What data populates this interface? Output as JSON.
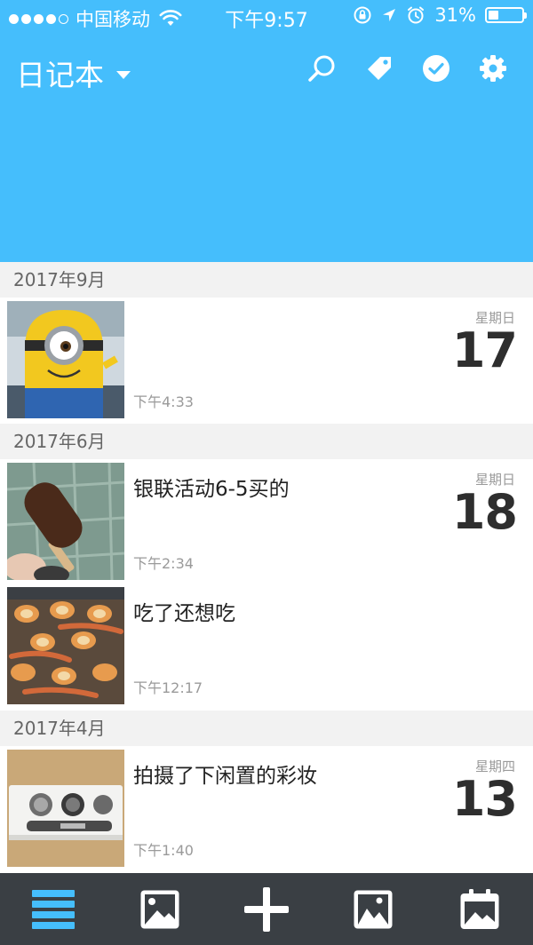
{
  "status_bar": {
    "carrier": "中国移动",
    "time": "下午9:57",
    "battery_percent": "31%",
    "battery_level": 0.31,
    "signal_filled": 4,
    "signal_total": 5,
    "icons": [
      "signal-dots-icon",
      "wifi-icon",
      "orientation-lock-icon",
      "location-arrow-icon",
      "alarm-icon",
      "battery-icon"
    ]
  },
  "nav": {
    "title": "日记本",
    "actions": [
      "search-icon",
      "tag-icon",
      "check-circle-icon",
      "gear-icon"
    ]
  },
  "colors": {
    "header_blue": "#45befc",
    "tabbar_bg": "#3a3f44",
    "active_tab": "#45befc",
    "month_bg": "#f2f2f2"
  },
  "groups": [
    {
      "month": "2017年9月",
      "weekday": "星期日",
      "day": "17",
      "entries": [
        {
          "title": "",
          "time": "下午4:33",
          "thumbnail": "minion-photo"
        }
      ]
    },
    {
      "month": "2017年6月",
      "weekday": "星期日",
      "day": "18",
      "entries": [
        {
          "title": "银联活动6-5买的",
          "time": "下午2:34",
          "thumbnail": "ice-cream-photo"
        },
        {
          "title": "吃了还想吃",
          "time": "下午12:17",
          "thumbnail": "seafood-photo"
        }
      ]
    },
    {
      "month": "2017年4月",
      "weekday": "星期四",
      "day": "13",
      "entries": [
        {
          "title": "拍摄了下闲置的彩妆",
          "time": "下午1:40",
          "thumbnail": "makeup-photo"
        }
      ]
    }
  ],
  "tabbar": {
    "tabs": [
      "list-icon",
      "photo-icon",
      "add-icon",
      "photos-icon",
      "calendar-icon"
    ],
    "active": 0
  }
}
